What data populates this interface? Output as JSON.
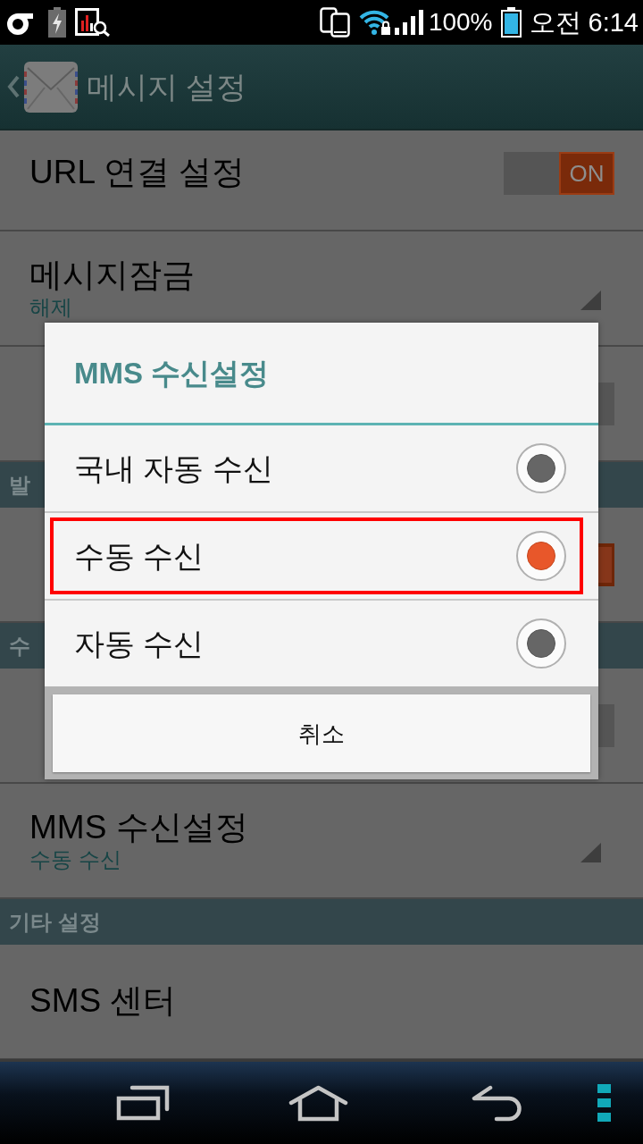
{
  "status_bar": {
    "battery_percent": "100%",
    "time": "오전 6:14"
  },
  "action_bar": {
    "title": "메시지 설정"
  },
  "settings": [
    {
      "kind": "toggle",
      "title": "URL 연결 설정",
      "on": true,
      "switch_label": "ON"
    },
    {
      "kind": "list",
      "title": "메시지잠금",
      "summary": "해제"
    },
    {
      "kind": "toggle",
      "on": false
    },
    {
      "kind": "header",
      "title": "발"
    },
    {
      "kind": "toggle",
      "on": true
    },
    {
      "kind": "header",
      "title": "수"
    },
    {
      "kind": "toggle",
      "on": false
    },
    {
      "kind": "list",
      "title": "MMS 수신설정",
      "summary": "수동 수신"
    },
    {
      "kind": "header",
      "title": "기타 설정"
    },
    {
      "kind": "plain",
      "title": "SMS 센터"
    }
  ],
  "dialog": {
    "title": "MMS 수신설정",
    "options": [
      {
        "label": "국내 자동 수신",
        "selected": false,
        "highlighted": false
      },
      {
        "label": "수동 수신",
        "selected": true,
        "highlighted": true
      },
      {
        "label": "자동 수신",
        "selected": false,
        "highlighted": false
      }
    ],
    "cancel_button": "취소"
  }
}
